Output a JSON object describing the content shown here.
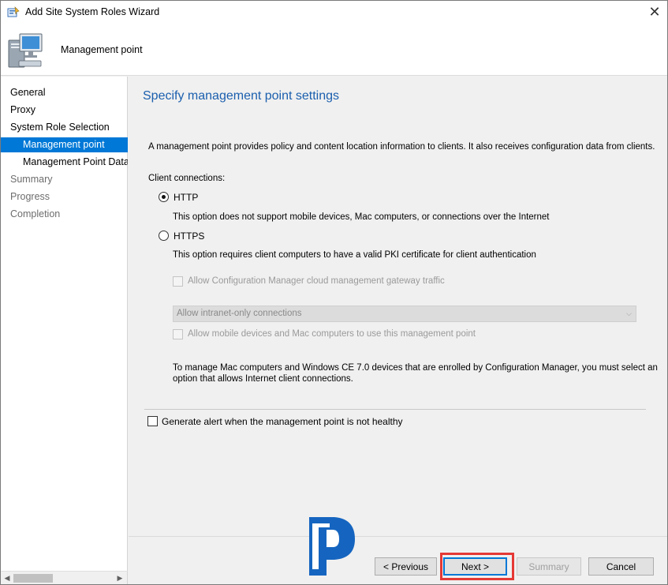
{
  "window": {
    "title": "Add Site System Roles Wizard",
    "close_glyph": "✕",
    "app_icon": "wizard-icon"
  },
  "header": {
    "subtitle": "Management point",
    "icon": "computer-icon"
  },
  "sidebar": {
    "items": [
      {
        "label": "General"
      },
      {
        "label": "Proxy"
      },
      {
        "label": "System Role Selection"
      },
      {
        "label": "Management point"
      },
      {
        "label": "Management Point Datab"
      },
      {
        "label": "Summary"
      },
      {
        "label": "Progress"
      },
      {
        "label": "Completion"
      }
    ],
    "scroll_left": "◀",
    "scroll_right": "▶"
  },
  "content": {
    "title": "Specify management point settings",
    "description": "A management point provides policy and content location information to clients.  It also receives configuration data from clients.",
    "client_connections_label": "Client connections:",
    "http": {
      "label": "HTTP",
      "selected": true,
      "description": "This option does not support mobile devices, Mac computers, or connections over the Internet"
    },
    "https": {
      "label": "HTTPS",
      "selected": false,
      "description": "This option requires client computers to have a valid PKI certificate for client authentication"
    },
    "cmg_checkbox_label": "Allow Configuration Manager cloud management gateway traffic",
    "connection_select_value": "Allow intranet-only connections",
    "select_chevron": "⌵",
    "mobile_checkbox_label": "Allow mobile devices and Mac computers to use this management point",
    "note_line1": "To manage Mac computers and Windows CE 7.0 devices that are enrolled by Configuration Manager, you must select an",
    "note_line2": "option that allows Internet client connections.",
    "alert_checkbox_label": "Generate alert when the management point is not healthy"
  },
  "buttons": {
    "previous": "< Previous",
    "next": "Next >",
    "summary": "Summary",
    "cancel": "Cancel"
  },
  "colors": {
    "accent": "#0078d7",
    "title_blue": "#1b5fae",
    "highlight": "#e53935",
    "logo_blue": "#1565c0"
  }
}
